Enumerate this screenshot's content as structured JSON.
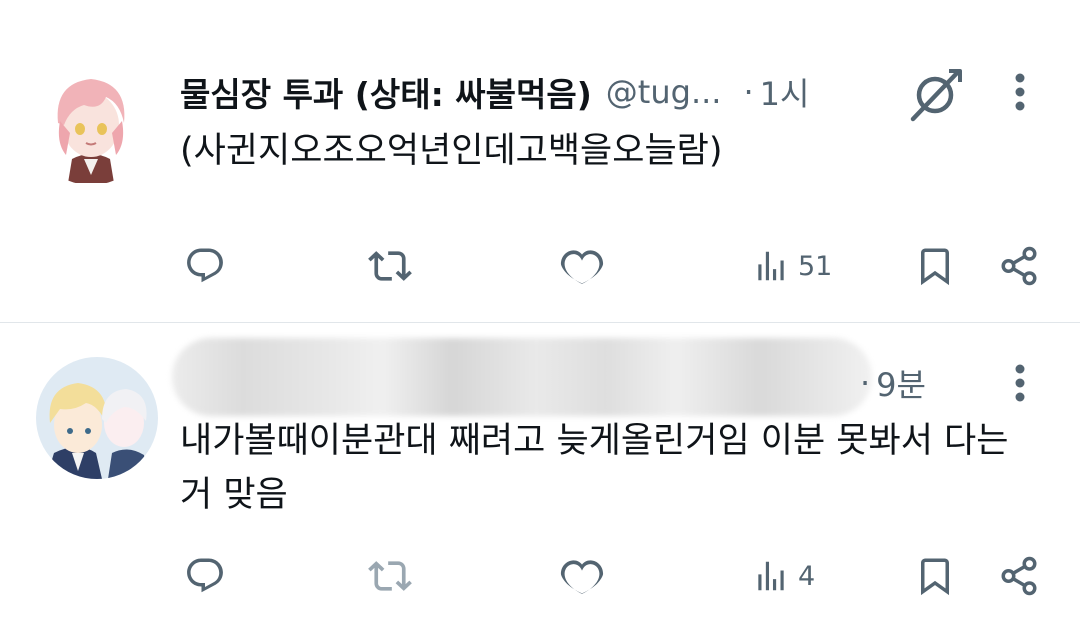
{
  "tweets": [
    {
      "display_name": "물심장 투과 (상태: 싸불먹음)",
      "handle": "@tug...",
      "separator": "·",
      "time": "1시",
      "text": "(사귄지오조오억년인데고백을오늘람)",
      "views": "51"
    },
    {
      "display_name": "",
      "handle": "",
      "separator": "·",
      "time": "9분",
      "text_line1": "내가볼때이분관대 째려고 늦게올린거임 이분 못봐서 다는",
      "text_line2": "거 맞음",
      "views": "4"
    }
  ],
  "icons": {
    "reply": "reply-icon",
    "retweet": "retweet-icon",
    "like": "heart-icon",
    "views": "views-chart-icon",
    "bookmark": "bookmark-icon",
    "share": "share-icon",
    "grok": "grok-icon",
    "more": "more-vertical-icon"
  },
  "colors": {
    "text": "#0f1419",
    "secondary": "#536471",
    "divider": "#e1e6ea",
    "retweet_disabled": "#9aa7b1"
  }
}
